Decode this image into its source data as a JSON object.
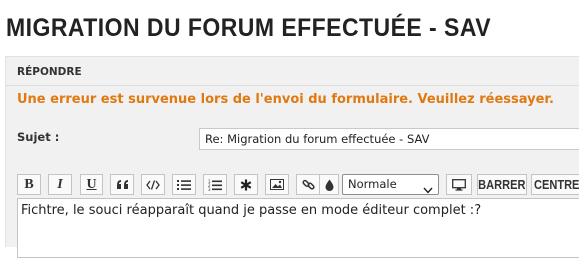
{
  "page": {
    "title": "MIGRATION DU FORUM EFFECTUÉE - SAV"
  },
  "reply": {
    "heading": "RÉPONDRE",
    "error_message": "Une erreur est survenue lors de l'envoi du formulaire. Veuillez réessayer.",
    "subject_label": "Sujet :",
    "subject_value": "Re: Migration du forum effectuée - SAV",
    "editor_text": "Fichtre, le souci réapparaît quand je passe en mode éditeur complet :?"
  },
  "toolbar": {
    "bold": "B",
    "italic": "I",
    "underline": "U",
    "font_size_selected": "Normale",
    "strike_label": "BARRER",
    "center_label": "CENTRER",
    "icons": [
      "bold-icon",
      "italic-icon",
      "underline-icon",
      "quote-icon",
      "code-icon",
      "bullet-list-icon",
      "numbered-list-icon",
      "list-item-star-icon",
      "image-icon",
      "link-icon",
      "color-drop-icon",
      "chevron-down-icon",
      "monitor-icon"
    ]
  },
  "colors": {
    "error": "#e07912",
    "panel_background": "#f1f1f1",
    "title_text": "#222222"
  }
}
